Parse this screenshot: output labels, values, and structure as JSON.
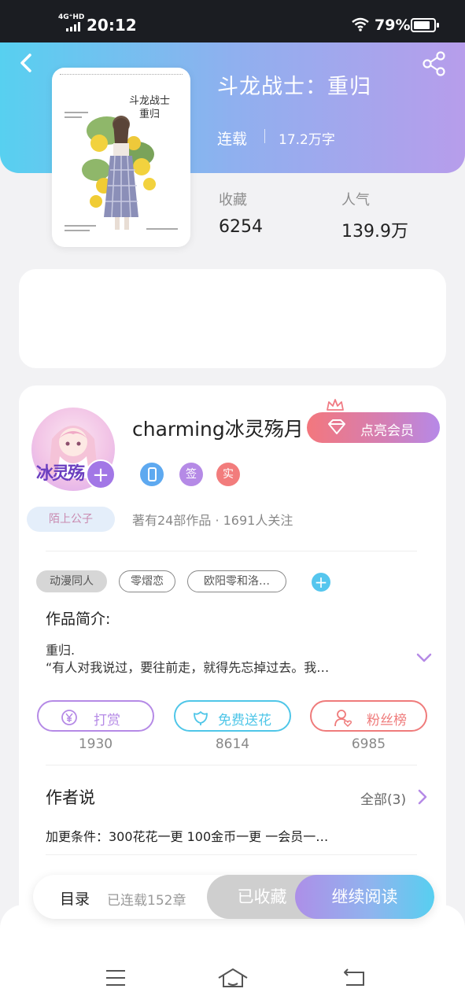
{
  "status_bar": {
    "network": "4G⁺HD",
    "time": "20:12",
    "battery_percent": "79%"
  },
  "header": {
    "icons": [
      "back-icon",
      "share-icon"
    ],
    "gradient": [
      "#57d0f0",
      "#b79deb"
    ]
  },
  "book": {
    "title": "斗龙战士：重归",
    "status": "连载",
    "word_count": "17.2万字",
    "cover_title_line1": "斗龙战士",
    "cover_title_line2": "重归",
    "stats": [
      {
        "label": "收藏",
        "value": "6254"
      },
      {
        "label": "人气",
        "value": "139.9万"
      }
    ]
  },
  "author": {
    "name": "charming冰灵殇月",
    "avatar_text": "冰灵殇",
    "follow_icon": "+",
    "vip_label": "点亮会员",
    "badges": [
      {
        "icon": "phone-icon",
        "text": "",
        "color": "#5ea9f0"
      },
      {
        "icon": "",
        "text": "签",
        "color": "#b58ae6"
      },
      {
        "icon": "",
        "text": "实",
        "color": "#f27c7c"
      }
    ],
    "title_tag": "陌上公子",
    "works_info": "著有24部作品 · 1691人关注"
  },
  "tags": [
    "动漫同人",
    "零熠恋",
    "欧阳零和洛…"
  ],
  "intro": {
    "heading": "作品简介:",
    "line1": "重归.",
    "line2": "“有人对我说过，要往前走，就得先忘掉过去。我…"
  },
  "actions": [
    {
      "label": "打赏",
      "count": "1930",
      "icon": "yen-icon",
      "color": "#b58ae6"
    },
    {
      "label": "免费送花",
      "count": "8614",
      "icon": "flower-icon",
      "color": "#4fc6e8"
    },
    {
      "label": "粉丝榜",
      "count": "6985",
      "icon": "fans-icon",
      "color": "#ef7b7b"
    }
  ],
  "author_says": {
    "heading": "作者说",
    "all_label": "全部(3)",
    "note": "加更条件：300花花一更 100金币一更 一会员一…"
  },
  "bottom_bar": {
    "catalog": "目录",
    "chapters": "已连载152章",
    "collected": "已收藏",
    "continue": "继续阅读"
  },
  "nav_bar": {
    "icons": [
      "menu-icon",
      "home-icon",
      "back-nav-icon"
    ]
  }
}
